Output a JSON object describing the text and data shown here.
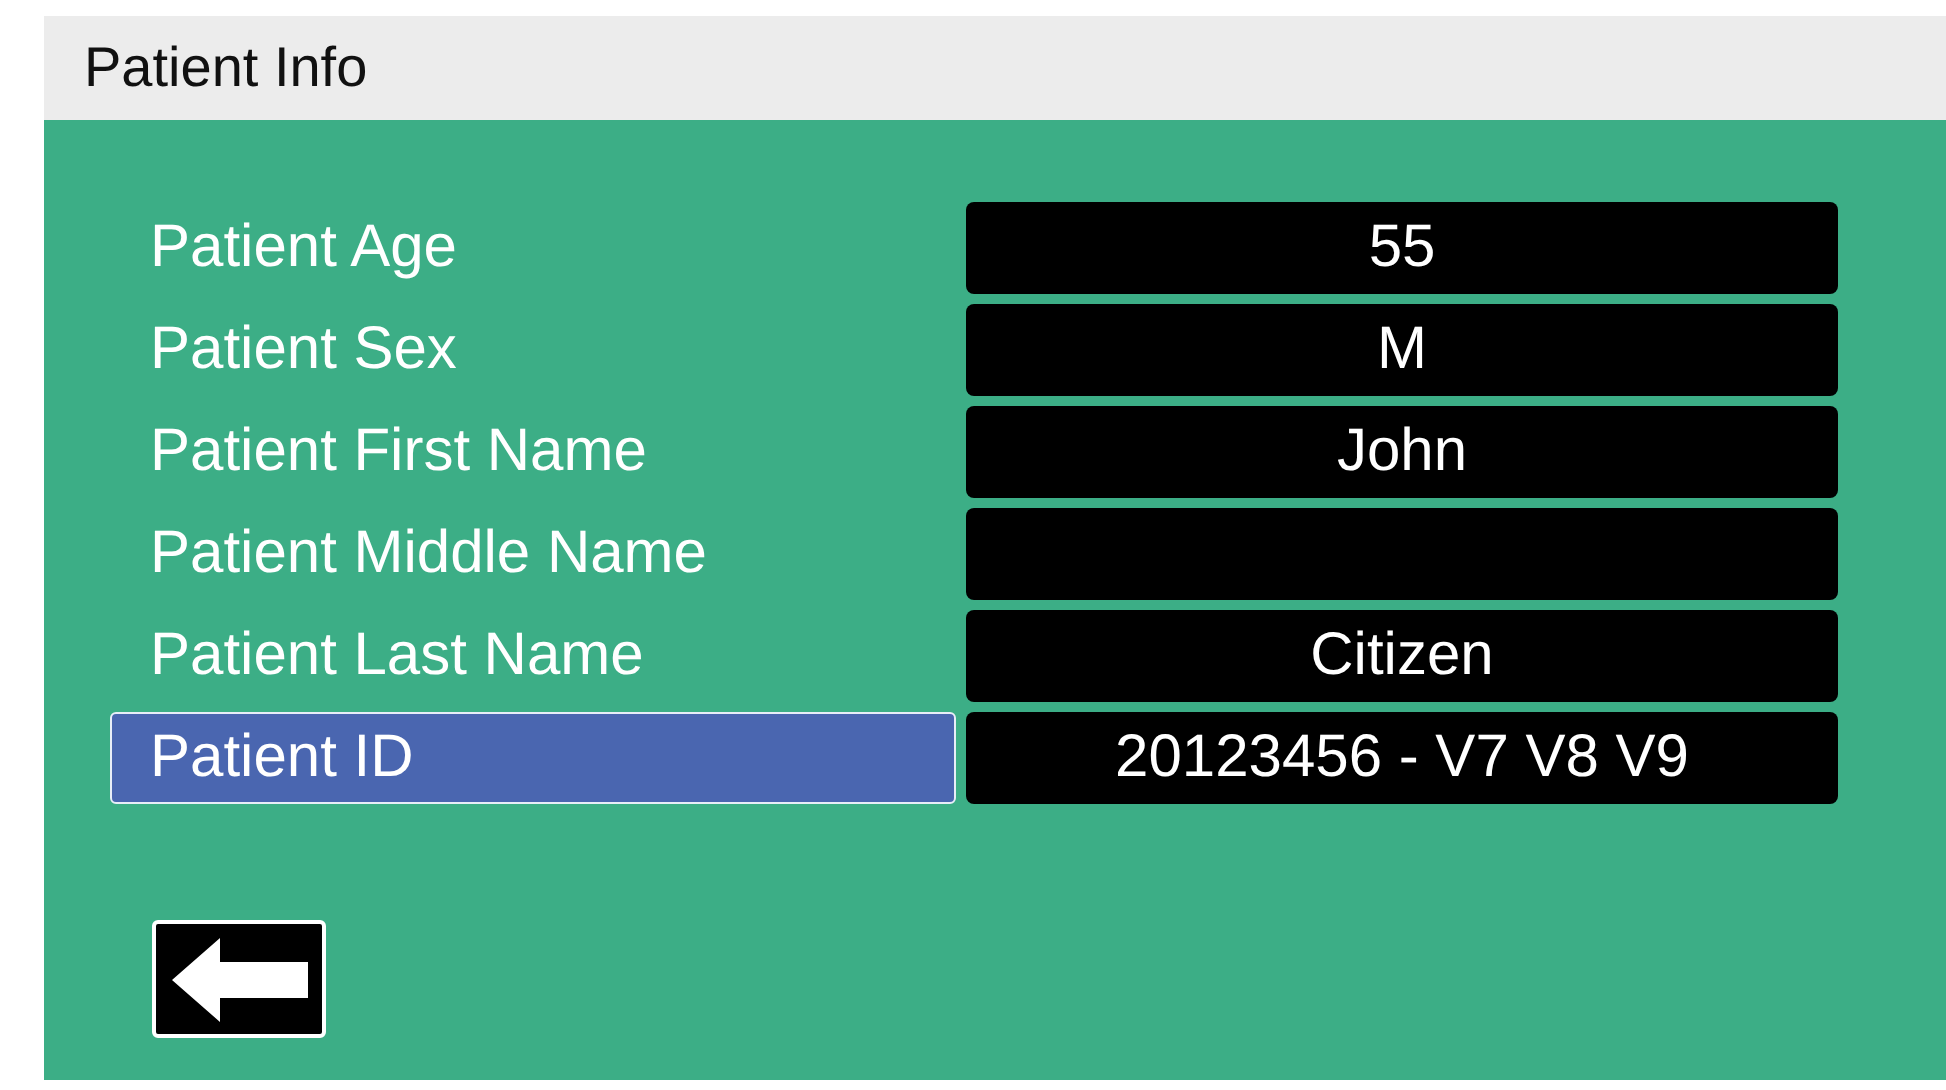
{
  "header": {
    "title": "Patient Info"
  },
  "fields": [
    {
      "label": "Patient Age",
      "value": "55",
      "selected": false
    },
    {
      "label": "Patient Sex",
      "value": "M",
      "selected": false
    },
    {
      "label": "Patient First Name",
      "value": "John",
      "selected": false
    },
    {
      "label": "Patient Middle Name",
      "selected": false
    },
    {
      "label": "Patient Last Name",
      "value": "Citizen",
      "selected": false
    },
    {
      "label": "Patient ID",
      "value": "20123456 - V7 V8 V9",
      "selected": true
    }
  ]
}
